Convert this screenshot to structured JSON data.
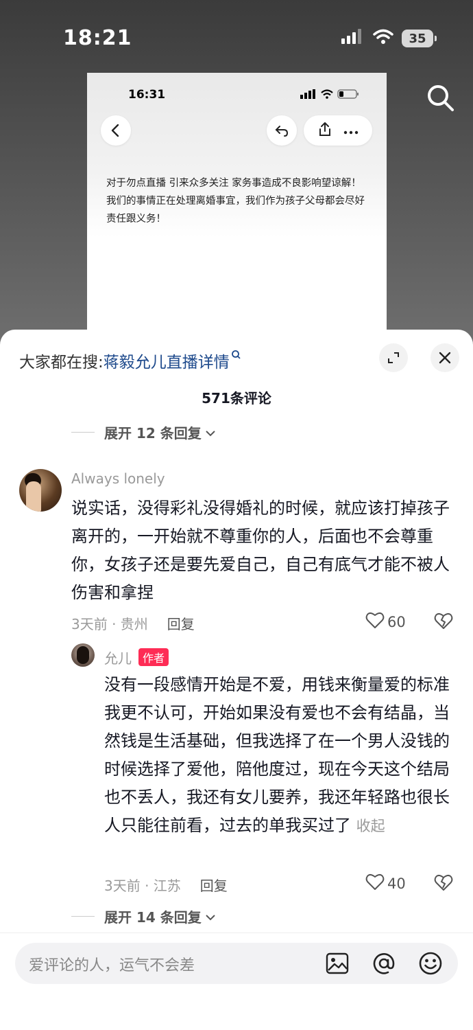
{
  "status_bar": {
    "time": "18:21",
    "battery": "35"
  },
  "screenshot": {
    "time": "16:31",
    "text": "对于勿点直播  引来众多关注 家务事造成不良影响望谅解！ 我们的事情正在处理离婚事宜，我们作为孩子父母都会尽好责任跟义务！"
  },
  "sheet": {
    "hot_search_prefix": "大家都在搜:",
    "hot_search_keyword": "蒋毅允儿直播详情",
    "comment_count": "571条评论",
    "expand_top": "展开 12 条回复",
    "expand_bottom": "展开 14 条回复"
  },
  "comment": {
    "username": "Always lonely",
    "text": "说实话，没得彩礼没得婚礼的时候，就应该打掉孩子离开的，一开始就不尊重你的人，后面也不会尊重你，女孩子还是要先爱自己，自己有底气才能不被人伤害和拿捏",
    "meta": "3天前 · 贵州",
    "reply_label": "回复",
    "likes": "60"
  },
  "reply": {
    "username": "允儿",
    "badge": "作者",
    "text": "没有一段感情开始是不爱，用钱来衡量爱的标准我更不认可，开始如果没有爱也不会有结晶，当然钱是生活基础，但我选择了在一个男人没钱的时候选择了爱他，陪他度过，现在今天这个结局也不丢人，我还有女儿要养，我还年轻路也很长人只能往前看，过去的单我买过了",
    "collapse": "收起",
    "meta": "3天前 · 江苏",
    "reply_label": "回复",
    "likes": "40"
  },
  "input": {
    "placeholder": "爱评论的人，运气不会差"
  },
  "icons": [
    "signal-icon",
    "wifi-icon",
    "battery-icon",
    "search-icon",
    "back-icon",
    "forward-icon",
    "share-icon",
    "more-icon",
    "expand-icon",
    "close-icon",
    "chevron-down-icon",
    "heart-icon",
    "dislike-icon",
    "image-icon",
    "at-icon",
    "emoji-icon"
  ]
}
